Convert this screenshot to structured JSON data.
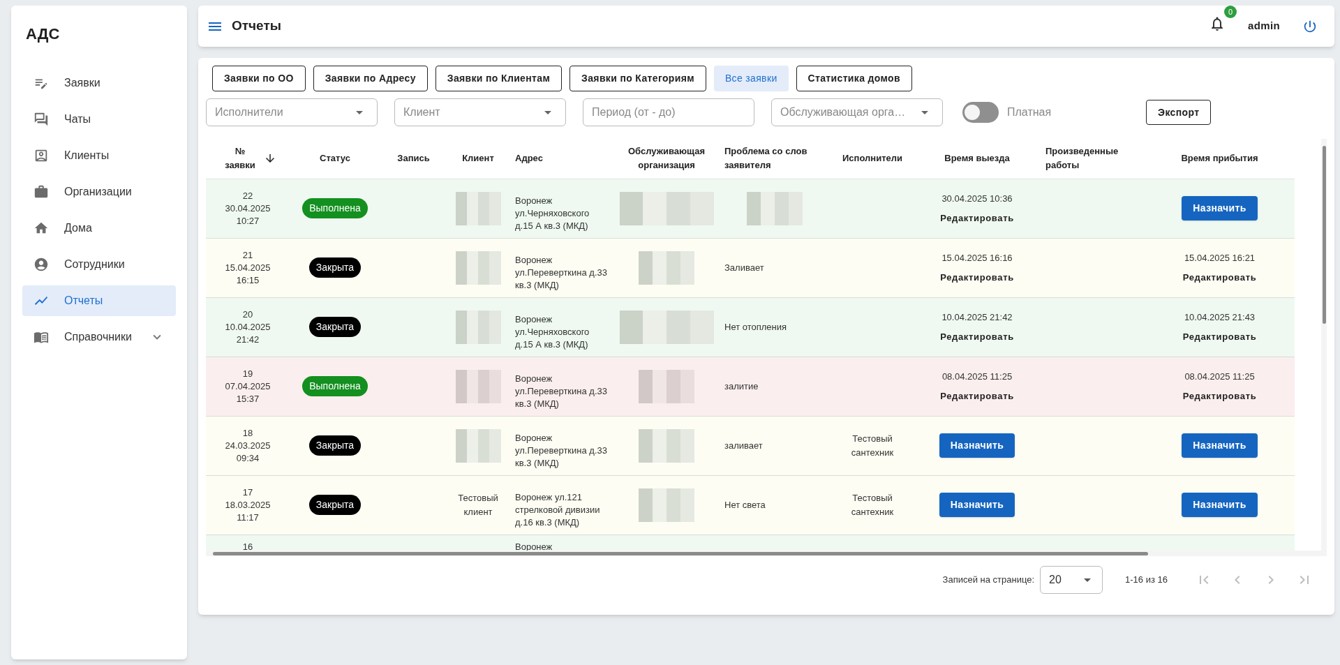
{
  "sidebar": {
    "title": "АДС",
    "items": [
      {
        "label": "Заявки",
        "kind": "link",
        "selected": false
      },
      {
        "label": "Чаты",
        "kind": "link",
        "selected": false
      },
      {
        "label": "Клиенты",
        "kind": "link",
        "selected": false
      },
      {
        "label": "Организации",
        "kind": "link",
        "selected": false
      },
      {
        "label": "Дома",
        "kind": "link",
        "selected": false
      },
      {
        "label": "Сотрудники",
        "kind": "link",
        "selected": false
      },
      {
        "label": "Отчеты",
        "kind": "link",
        "selected": true
      },
      {
        "label": "Справочники",
        "kind": "group",
        "expanded": false,
        "selected": false
      }
    ]
  },
  "header": {
    "title": "Отчеты",
    "notification_count": "0",
    "user": "admin"
  },
  "report_tabs": [
    {
      "label": "Заявки по ОО",
      "selected": false
    },
    {
      "label": "Заявки по Адресу",
      "selected": false
    },
    {
      "label": "Заявки по Клиентам",
      "selected": false
    },
    {
      "label": "Заявки по Категориям",
      "selected": false
    },
    {
      "label": "Все заявки",
      "selected": true
    },
    {
      "label": "Статистика домов",
      "selected": false
    }
  ],
  "filters": [
    {
      "kind": "select",
      "placeholder": "Исполнители"
    },
    {
      "kind": "select",
      "placeholder": "Клиент"
    },
    {
      "kind": "input",
      "placeholder": "Период (от - до)"
    },
    {
      "kind": "select",
      "placeholder": "Обслуживающая орга…"
    }
  ],
  "paid_toggle": {
    "label": "Платная",
    "on": false
  },
  "export_button": "Экспорт",
  "table": {
    "columns": [
      {
        "label": "№ заявки",
        "sorted": true
      },
      {
        "label": "Статус",
        "sorted": false
      },
      {
        "label": "Запись",
        "sorted": false
      },
      {
        "label": "Клиент",
        "sorted": false
      },
      {
        "label": "Адрес",
        "sorted": false
      },
      {
        "label": "Обслуживающая организация",
        "sorted": false
      },
      {
        "label": "Проблема со слов заявителя",
        "sorted": false
      },
      {
        "label": "Исполнители",
        "sorted": false
      },
      {
        "label": "Время выезда",
        "sorted": false
      },
      {
        "label": "Произведенные работы",
        "sorted": false
      },
      {
        "label": "Время прибытия",
        "sorted": false
      }
    ],
    "rows": [
      {
        "color": "#eff9f1",
        "number": "22",
        "date": "30.04.2025",
        "time": "10:27",
        "status": {
          "label": "Выполнена",
          "kind": "done"
        },
        "client": {
          "hidden": true
        },
        "address": "Воронеж ул.Черняховского д.15 А кв.3 (МКД)",
        "organization": {
          "hidden": true
        },
        "problem": {
          "hidden": true
        },
        "departure": {
          "kind": "time",
          "time": "30.04.2025 10:36",
          "action": "Редактировать"
        },
        "arrival": {
          "kind": "button",
          "label": "Назначить"
        }
      },
      {
        "color": "#fdfdf3",
        "number": "21",
        "date": "15.04.2025",
        "time": "16:15",
        "status": {
          "label": "Закрыта",
          "kind": "closed"
        },
        "client": {
          "hidden": true
        },
        "address": "Воронеж ул.Переверткина д.33 кв.3 (МКД)",
        "organization": {
          "hidden": true
        },
        "problem": {
          "hidden": false,
          "text": "Заливает"
        },
        "departure": {
          "kind": "time",
          "time": "15.04.2025 16:16",
          "action": "Редактировать"
        },
        "arrival": {
          "kind": "time",
          "time": "15.04.2025 16:21",
          "action": "Редактировать"
        }
      },
      {
        "color": "#eff9f1",
        "number": "20",
        "date": "10.04.2025",
        "time": "21:42",
        "status": {
          "label": "Закрыта",
          "kind": "closed"
        },
        "client": {
          "hidden": true
        },
        "address": "Воронеж ул.Черняховского д.15 А кв.3 (МКД)",
        "organization": {
          "hidden": true
        },
        "problem": {
          "hidden": false,
          "text": "Нет отопления"
        },
        "departure": {
          "kind": "time",
          "time": "10.04.2025 21:42",
          "action": "Редактировать"
        },
        "arrival": {
          "kind": "time",
          "time": "10.04.2025 21:43",
          "action": "Редактировать"
        }
      },
      {
        "color": "#fbeeee",
        "number": "19",
        "date": "07.04.2025",
        "time": "15:37",
        "status": {
          "label": "Выполнена",
          "kind": "done"
        },
        "client": {
          "hidden": true
        },
        "address": "Воронеж ул.Переверткина д.33 кв.3 (МКД)",
        "organization": {
          "hidden": true
        },
        "problem": {
          "hidden": false,
          "text": "залитие"
        },
        "departure": {
          "kind": "time",
          "time": "08.04.2025 11:25",
          "action": "Редактировать"
        },
        "arrival": {
          "kind": "time",
          "time": "08.04.2025 11:25",
          "action": "Редактировать"
        }
      },
      {
        "color": "#fdfdf3",
        "number": "18",
        "date": "24.03.2025",
        "time": "09:34",
        "status": {
          "label": "Закрыта",
          "kind": "closed"
        },
        "client": {
          "hidden": true
        },
        "address": "Воронеж ул.Переверткина д.33 кв.3 (МКД)",
        "organization": {
          "hidden": true
        },
        "problem": {
          "hidden": false,
          "text": "заливает"
        },
        "executors": "Тестовый сантехник",
        "departure": {
          "kind": "button",
          "label": "Назначить"
        },
        "arrival": {
          "kind": "button",
          "label": "Назначить"
        }
      },
      {
        "color": "#fdfdf3",
        "number": "17",
        "date": "18.03.2025",
        "time": "11:17",
        "status": {
          "label": "Закрыта",
          "kind": "closed"
        },
        "client": {
          "hidden": false,
          "text": "Тестовый клиент"
        },
        "address": "Воронеж ул.121 стрелковой дивизии д.16 кв.3 (МКД)",
        "organization": {
          "hidden": true
        },
        "problem": {
          "hidden": false,
          "text": "Нет света"
        },
        "executors": "Тестовый сантехник",
        "departure": {
          "kind": "button",
          "label": "Назначить"
        },
        "arrival": {
          "kind": "button",
          "label": "Назначить"
        }
      },
      {
        "color": "#eff9f1",
        "number": "16",
        "address": "Воронеж"
      }
    ]
  },
  "pagination": {
    "rows_per_page_label": "Записей на странице:",
    "rows_per_page": "20",
    "range": "1-16 из 16"
  }
}
